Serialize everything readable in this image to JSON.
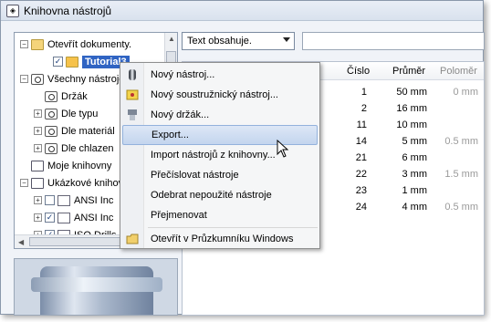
{
  "window": {
    "title": "Knihovna nástrojů"
  },
  "tree": {
    "items": [
      {
        "label": "Otevřít dokumenty.",
        "expander": "−"
      },
      {
        "label": "Tutorial3",
        "checked": true
      },
      {
        "label": "Všechny nástroje",
        "expander": "−"
      },
      {
        "label": "Držák"
      },
      {
        "label": "Dle typu",
        "expander": "+"
      },
      {
        "label": "Dle materiál",
        "expander": "+"
      },
      {
        "label": "Dle chlazen",
        "expander": "+"
      },
      {
        "label": "Moje knihovny"
      },
      {
        "label": "Ukázkové knihov",
        "expander": "−"
      },
      {
        "label": "ANSI Inc",
        "expander": "+",
        "checked": false
      },
      {
        "label": "ANSI Inc",
        "expander": "+",
        "checked": true
      },
      {
        "label": "ISO Drills",
        "expander": "+",
        "checked": true
      }
    ]
  },
  "filter": {
    "label": "Text obsahuje."
  },
  "table": {
    "headers": {
      "number": "Číslo",
      "diameter": "Průměr",
      "radius": "Poloměr"
    },
    "rows": [
      {
        "number": "1",
        "diameter": "50 mm",
        "radius": "0 mm"
      },
      {
        "number": "2",
        "diameter": "16 mm",
        "radius": ""
      },
      {
        "number": "11",
        "diameter": "10 mm",
        "radius": ""
      },
      {
        "number": "14",
        "diameter": "5 mm",
        "radius": "0.5 mm"
      },
      {
        "number": "21",
        "diameter": "6 mm",
        "radius": ""
      },
      {
        "number": "22",
        "diameter": "3 mm",
        "radius": "1.5 mm"
      },
      {
        "number": "23",
        "diameter": "1 mm",
        "radius": ""
      },
      {
        "number": "24",
        "diameter": "4 mm",
        "radius": "0.5 mm"
      }
    ]
  },
  "context_menu": {
    "items": [
      {
        "label": "Nový nástroj...",
        "icon": "mill-tool-icon"
      },
      {
        "label": "Nový soustružnický nástroj...",
        "icon": "turning-tool-icon"
      },
      {
        "label": "Nový držák...",
        "icon": "holder-icon"
      },
      {
        "label": "Export...",
        "highlighted": true
      },
      {
        "label": "Import nástrojů z knihovny..."
      },
      {
        "label": "Přečíslovat nástroje"
      },
      {
        "label": "Odebrat nepoužité nástroje"
      },
      {
        "label": "Přejmenovat"
      },
      {
        "label": "Otevřít v Průzkumníku Windows",
        "icon": "folder-icon"
      }
    ]
  },
  "colors": {
    "selection": "#3064c3",
    "menu_highlight": "#c3d5ee"
  }
}
